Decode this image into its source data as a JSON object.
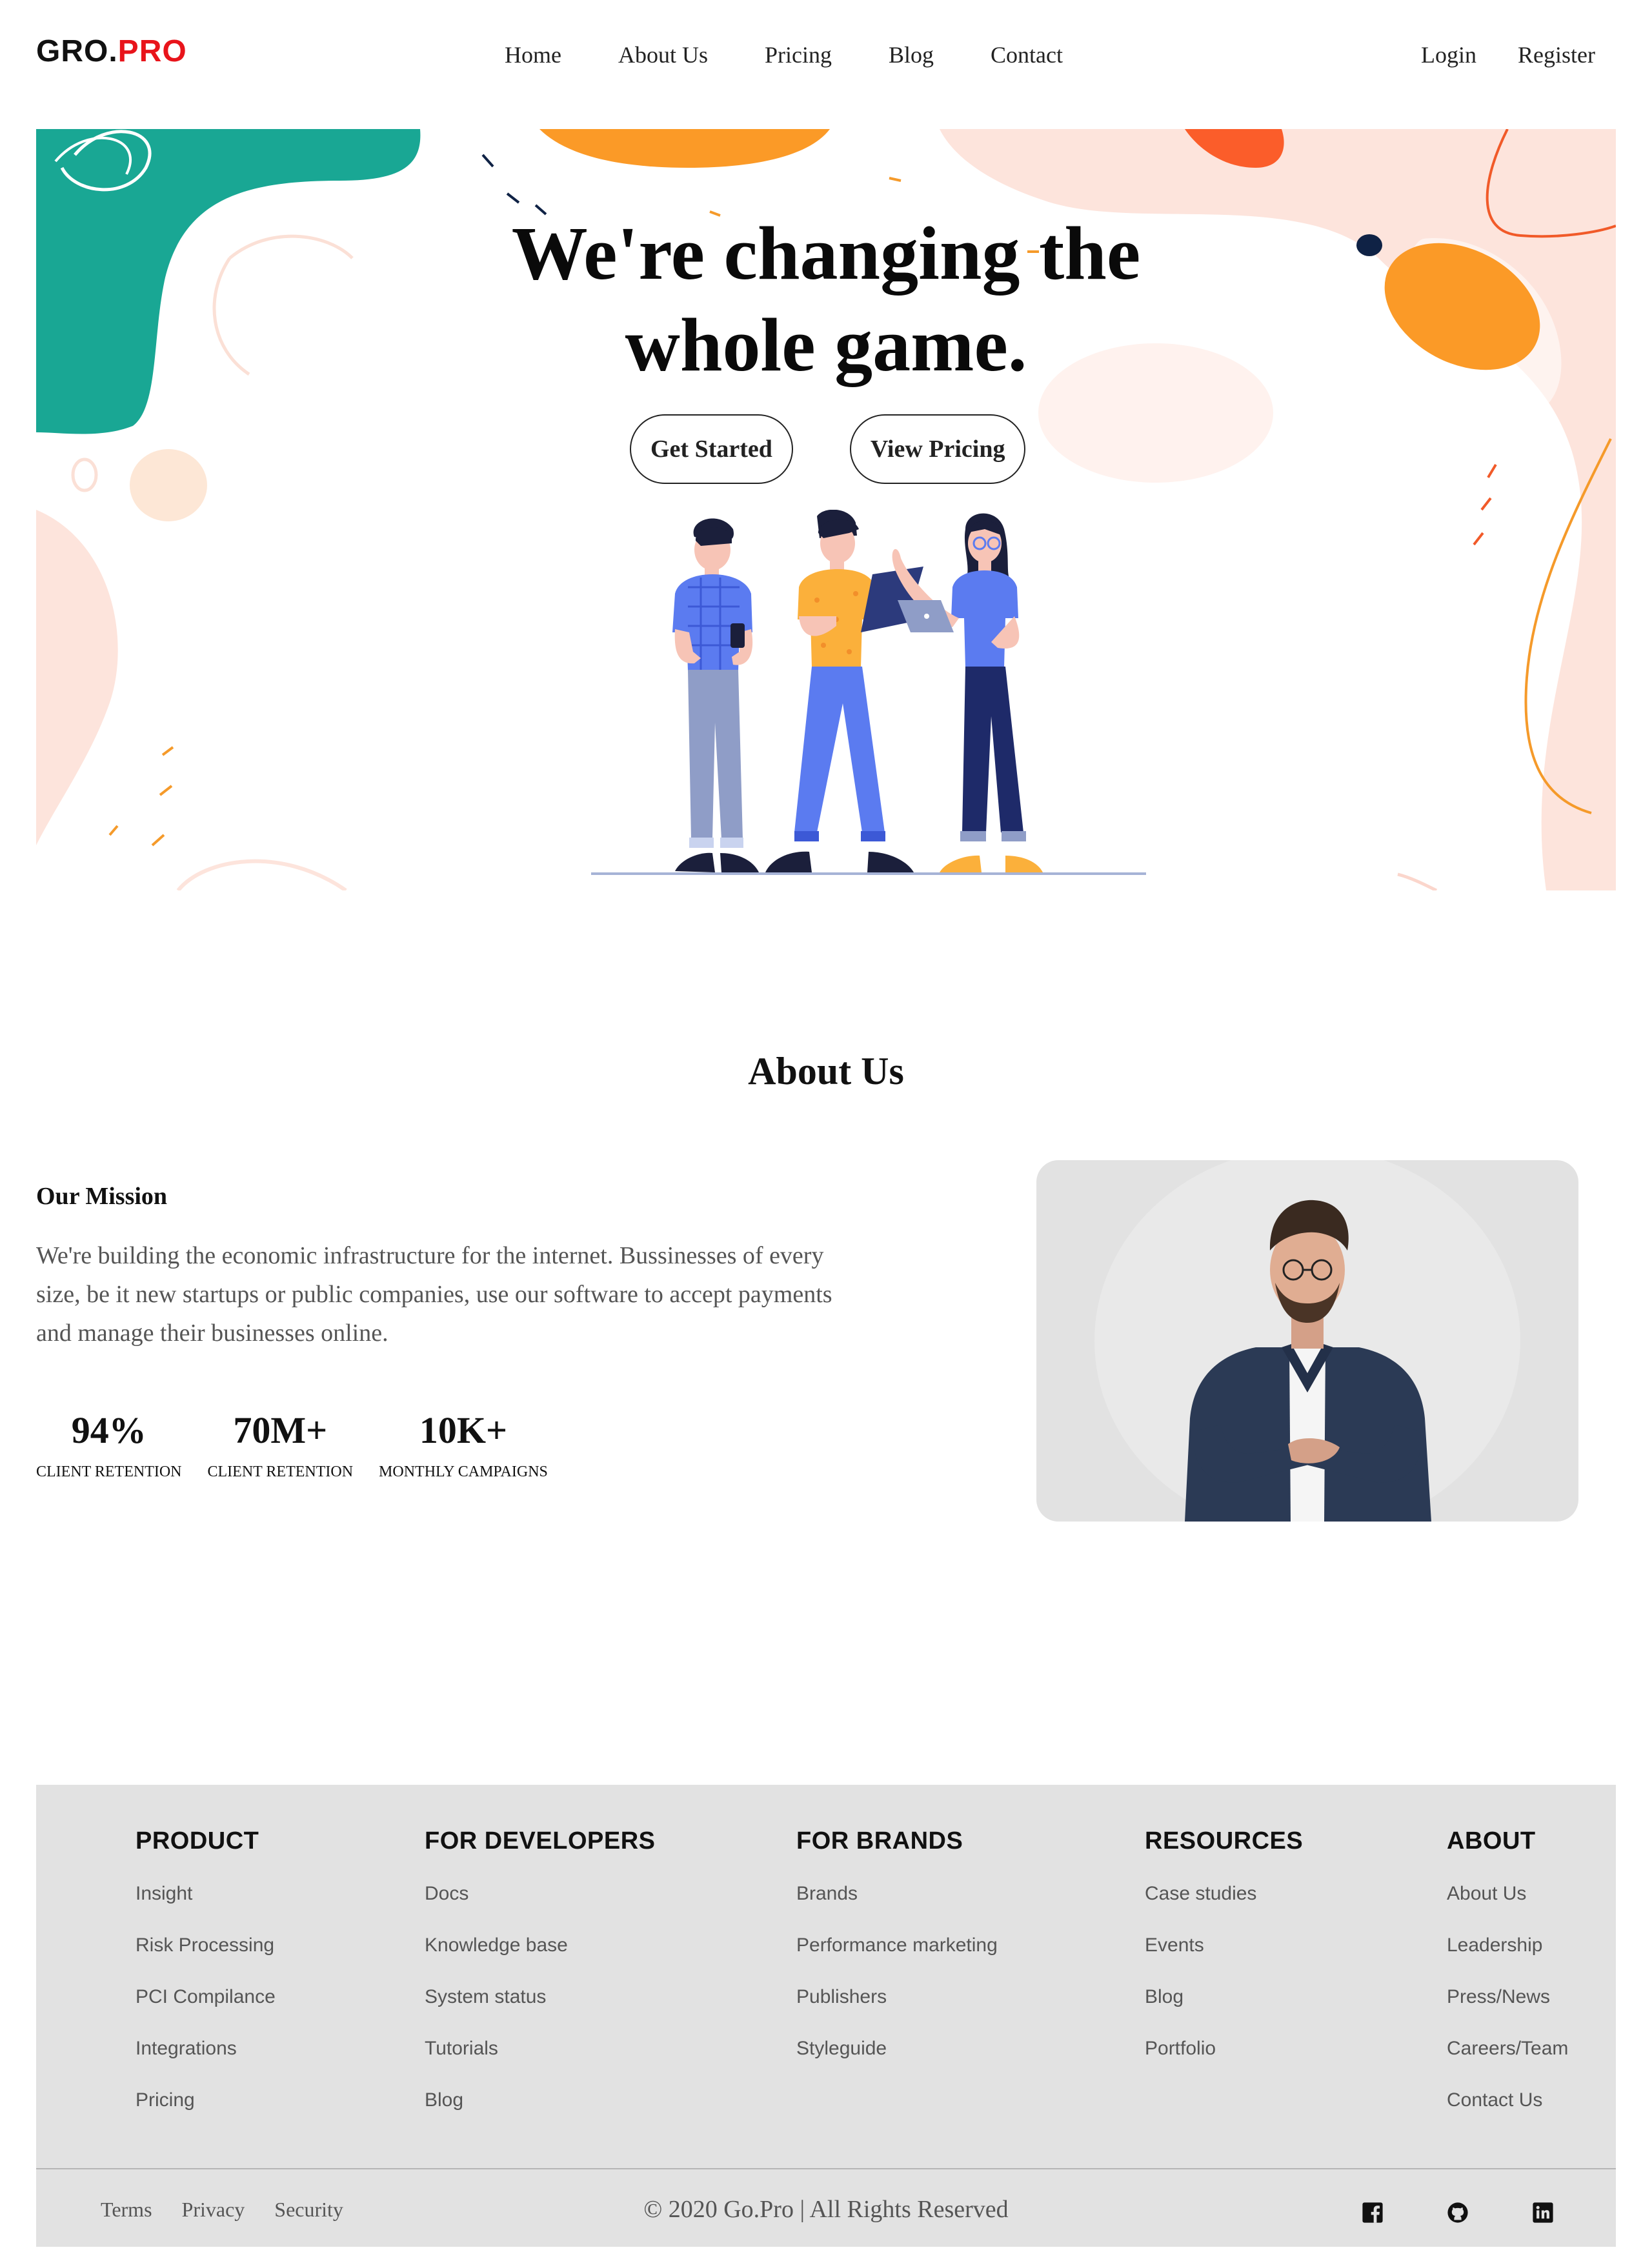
{
  "nav": {
    "logo_main": "GRO.",
    "logo_accent": "PRO",
    "links": [
      "Home",
      "About Us",
      "Pricing",
      "Blog",
      "Contact"
    ],
    "auth": [
      "Login",
      "Register"
    ]
  },
  "hero": {
    "title_line1": "We're changing the",
    "title_line2": "whole game.",
    "buttons": [
      "Get Started",
      "View Pricing"
    ]
  },
  "about": {
    "heading": "About Us",
    "mission_title": "Our Mission",
    "mission_text": "We're building the economic infrastructure for the internet. Bussinesses of every size, be it new startups or public companies, use our software to accept payments and manage their businesses online.",
    "stats": [
      {
        "value": "94%",
        "label": "CLIENT RETENTION"
      },
      {
        "value": "70M+",
        "label": "CLIENT RETENTION"
      },
      {
        "value": "10K+",
        "label": "MONTHLY CAMPAIGNS"
      }
    ]
  },
  "footer": {
    "columns": [
      {
        "title": "PRODUCT",
        "items": [
          "Insight",
          "Risk Processing",
          "PCI Compilance",
          "Integrations",
          "Pricing"
        ]
      },
      {
        "title": "FOR DEVELOPERS",
        "items": [
          "Docs",
          "Knowledge base",
          "System status",
          "Tutorials",
          "Blog"
        ]
      },
      {
        "title": "FOR BRANDS",
        "items": [
          "Brands",
          "Performance marketing",
          "Publishers",
          "Styleguide"
        ]
      },
      {
        "title": "RESOURCES",
        "items": [
          "Case studies",
          "Events",
          "Blog",
          "Portfolio"
        ]
      },
      {
        "title": "ABOUT",
        "items": [
          "About Us",
          "Leadership",
          "Press/News",
          "Careers/Team",
          "Contact Us"
        ]
      }
    ],
    "bottom_links": [
      "Terms",
      "Privacy",
      "Security"
    ],
    "copyright": "© 2020 Go.Pro | All Rights Reserved",
    "socials": [
      "facebook-icon",
      "github-icon",
      "linkedin-icon"
    ]
  },
  "colors": {
    "accent": "#e8141b",
    "teal": "#19a794",
    "orange": "#fb9a27",
    "peach": "#fde4dc",
    "footer_bg": "#e2e2e2"
  }
}
